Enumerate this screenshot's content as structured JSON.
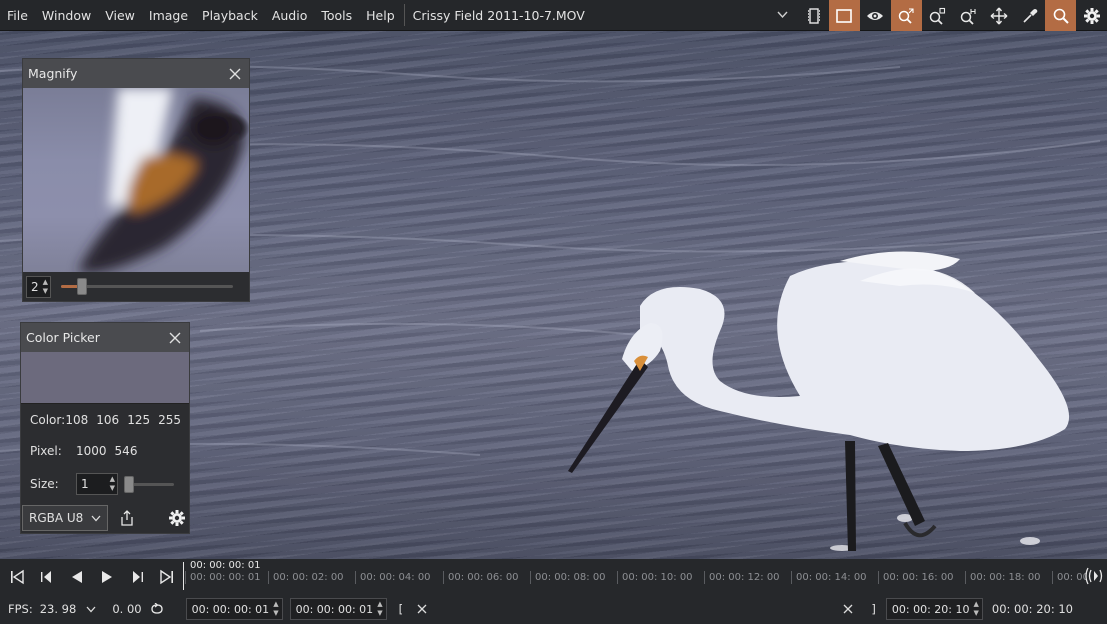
{
  "menubar": {
    "items": [
      "File",
      "Window",
      "View",
      "Image",
      "Playback",
      "Audio",
      "Tools",
      "Help"
    ],
    "file_title": "Crissy Field 2011-10-7.MOV"
  },
  "toolbar": {
    "buttons": [
      {
        "icon": "filmstrip-icon",
        "active": false
      },
      {
        "icon": "frame-rectangle-icon",
        "active": true
      },
      {
        "icon": "eye-icon",
        "active": true
      },
      {
        "icon": "zoom-fit-icon",
        "active": true
      },
      {
        "icon": "zoom-window-icon",
        "active": false
      },
      {
        "icon": "zoom-height-icon",
        "active": false
      },
      {
        "icon": "pan-move-icon",
        "active": false
      },
      {
        "icon": "eyedropper-icon",
        "active": false
      },
      {
        "icon": "magnify-icon",
        "active": true
      },
      {
        "icon": "gear-icon",
        "active": false
      }
    ],
    "accent_color": "#b36c44"
  },
  "magnify": {
    "title": "Magnify",
    "zoom_value": "2",
    "zoom_slider_fraction": 0.12
  },
  "color_picker": {
    "title": "Color Picker",
    "swatch_color": "#6c6a7d",
    "color_label": "Color:",
    "color_values": [
      "108",
      "106",
      "125",
      "255"
    ],
    "pixel_label": "Pixel:",
    "pixel_values": [
      "1000",
      "546"
    ],
    "size_label": "Size:",
    "size_value": "1",
    "format": "RGBA U8"
  },
  "timeline": {
    "current_time": "00: 00: 00: 01",
    "ticks": [
      "00: 00: 00: 01",
      "00: 00: 02: 00",
      "00: 00: 04: 00",
      "00: 00: 06: 00",
      "00: 00: 08: 00",
      "00: 00: 10: 00",
      "00: 00: 12: 00",
      "00: 00: 14: 00",
      "00: 00: 16: 00",
      "00: 00: 18: 00",
      "00: 00:"
    ]
  },
  "statusbar": {
    "fps_label": "FPS:",
    "fps_value": "23. 98",
    "speed_value": "0. 00",
    "in_time": "00: 00: 00: 01",
    "current_time": "00: 00: 00: 01",
    "in_bracket": "[",
    "out_bracket": "]",
    "out_time": "00: 00: 20: 10",
    "duration": "00: 00: 20: 10"
  }
}
